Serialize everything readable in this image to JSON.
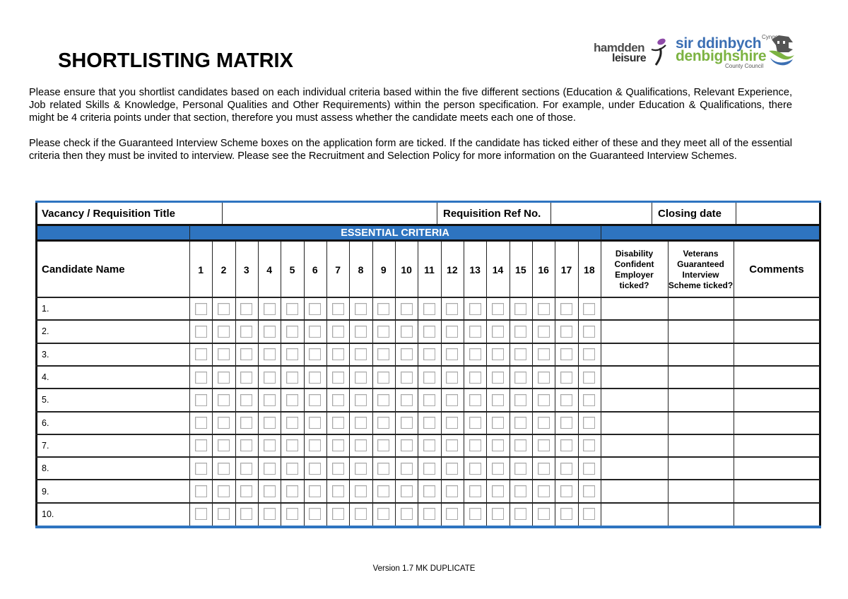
{
  "document": {
    "title": "SHORTLISTING MATRIX",
    "intro_paragraphs": [
      "Please ensure that you shortlist candidates based on each individual criteria based within the five different sections (Education & Qualifications, Relevant Experience, Job related Skills & Knowledge, Personal Qualities and Other Requirements) within the person specification.  For example, under Education & Qualifications, there might be 4 criteria points under that section, therefore you must assess whether the candidate meets each one of those.",
      "Please check if the Guaranteed Interview Scheme boxes on the application form are ticked.  If the candidate has ticked either of these and they meet all of the essential criteria then they must be invited to interview.  Please see the Recruitment and Selection Policy for more information on the Guaranteed Interview Schemes."
    ],
    "footer": "Version 1.7 MK DUPLICATE"
  },
  "logos": {
    "hamdden": {
      "line1": "hamdden",
      "line2": "leisure",
      "icon": "leisure-figure-icon"
    },
    "council": {
      "cyngor": "Cyngor",
      "welsh_name": "sir ddinbych",
      "english_name": "denbighshire",
      "subtitle": "County Council",
      "icon": "council-castle-emblem-icon"
    }
  },
  "colors": {
    "accent_blue": "#2e74c0",
    "council_blue": "#3b6fb3",
    "council_green": "#7cb342",
    "border": "#222222",
    "checkbox_border": "#a9a9a9"
  },
  "matrix": {
    "vacancy_row": {
      "vacancy_label": "Vacancy / Requisition Title",
      "vacancy_value": "",
      "ref_label": "Requisition Ref No.",
      "ref_value": "",
      "closing_label": "Closing date",
      "closing_value": ""
    },
    "band_label": "ESSENTIAL CRITERIA",
    "headers": {
      "candidate": "Candidate Name",
      "criteria": [
        "1",
        "2",
        "3",
        "4",
        "5",
        "6",
        "7",
        "8",
        "9",
        "10",
        "11",
        "12",
        "13",
        "14",
        "15",
        "16",
        "17",
        "18"
      ],
      "disability": "Disability Confident Employer ticked?",
      "veterans": "Veterans Guaranteed Interview Scheme ticked?",
      "comments": "Comments"
    },
    "rows": [
      {
        "label": "1.",
        "checks": [
          false,
          false,
          false,
          false,
          false,
          false,
          false,
          false,
          false,
          false,
          false,
          false,
          false,
          false,
          false,
          false,
          false,
          false
        ],
        "disability": "",
        "veterans": "",
        "comments": ""
      },
      {
        "label": "2.",
        "checks": [
          false,
          false,
          false,
          false,
          false,
          false,
          false,
          false,
          false,
          false,
          false,
          false,
          false,
          false,
          false,
          false,
          false,
          false
        ],
        "disability": "",
        "veterans": "",
        "comments": ""
      },
      {
        "label": "3.",
        "checks": [
          false,
          false,
          false,
          false,
          false,
          false,
          false,
          false,
          false,
          false,
          false,
          false,
          false,
          false,
          false,
          false,
          false,
          false
        ],
        "disability": "",
        "veterans": "",
        "comments": ""
      },
      {
        "label": "4.",
        "checks": [
          false,
          false,
          false,
          false,
          false,
          false,
          false,
          false,
          false,
          false,
          false,
          false,
          false,
          false,
          false,
          false,
          false,
          false
        ],
        "disability": "",
        "veterans": "",
        "comments": ""
      },
      {
        "label": "5.",
        "checks": [
          false,
          false,
          false,
          false,
          false,
          false,
          false,
          false,
          false,
          false,
          false,
          false,
          false,
          false,
          false,
          false,
          false,
          false
        ],
        "disability": "",
        "veterans": "",
        "comments": ""
      },
      {
        "label": "6.",
        "checks": [
          false,
          false,
          false,
          false,
          false,
          false,
          false,
          false,
          false,
          false,
          false,
          false,
          false,
          false,
          false,
          false,
          false,
          false
        ],
        "disability": "",
        "veterans": "",
        "comments": ""
      },
      {
        "label": "7.",
        "checks": [
          false,
          false,
          false,
          false,
          false,
          false,
          false,
          false,
          false,
          false,
          false,
          false,
          false,
          false,
          false,
          false,
          false,
          false
        ],
        "disability": "",
        "veterans": "",
        "comments": ""
      },
      {
        "label": "8.",
        "checks": [
          false,
          false,
          false,
          false,
          false,
          false,
          false,
          false,
          false,
          false,
          false,
          false,
          false,
          false,
          false,
          false,
          false,
          false
        ],
        "disability": "",
        "veterans": "",
        "comments": ""
      },
      {
        "label": "9.",
        "checks": [
          false,
          false,
          false,
          false,
          false,
          false,
          false,
          false,
          false,
          false,
          false,
          false,
          false,
          false,
          false,
          false,
          false,
          false
        ],
        "disability": "",
        "veterans": "",
        "comments": ""
      },
      {
        "label": "10.",
        "checks": [
          false,
          false,
          false,
          false,
          false,
          false,
          false,
          false,
          false,
          false,
          false,
          false,
          false,
          false,
          false,
          false,
          false,
          false
        ],
        "disability": "",
        "veterans": "",
        "comments": ""
      }
    ]
  }
}
